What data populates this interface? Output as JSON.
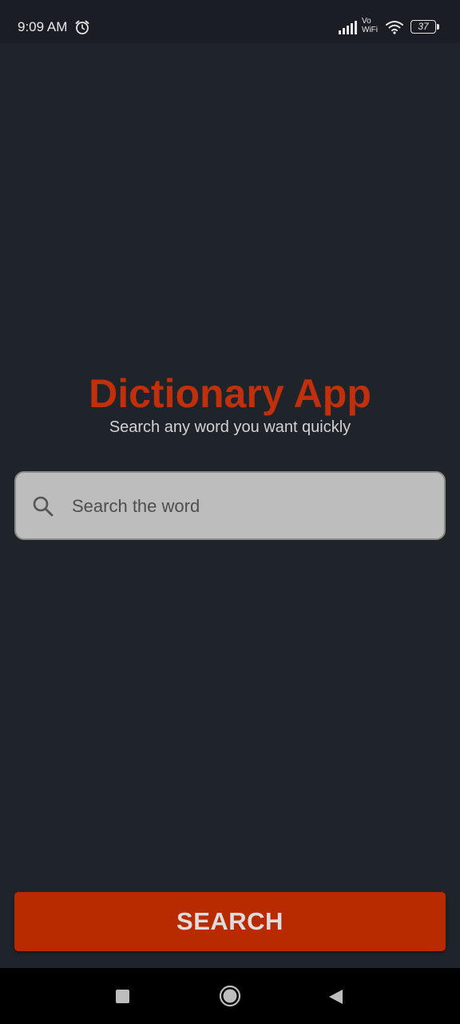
{
  "status_bar": {
    "time": "9:09 AM",
    "vowifi_top": "Vo",
    "vowifi_bottom": "WiFi",
    "battery_level": "37",
    "icons": [
      "alarm-icon",
      "signal-icon",
      "wifi-icon",
      "battery-icon"
    ]
  },
  "header": {
    "title": "Dictionary App",
    "subtitle": "Search any word you want quickly"
  },
  "search": {
    "placeholder": "Search the word",
    "value": "",
    "icon": "search-icon"
  },
  "actions": {
    "search_label": "SEARCH"
  },
  "nav_bar": {
    "icons": [
      "recents-icon",
      "home-icon",
      "back-icon"
    ]
  },
  "colors": {
    "background": "#1f232a",
    "accent": "#c0300c",
    "button": "#b82b00",
    "search_field": "#bdbdbd"
  }
}
